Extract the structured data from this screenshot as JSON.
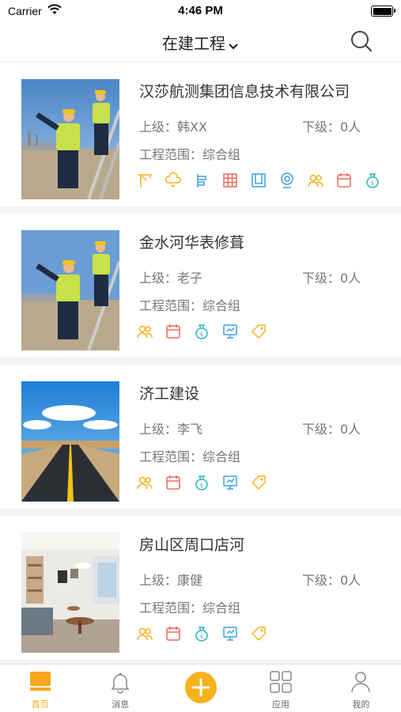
{
  "status": {
    "carrier": "Carrier",
    "time": "4:46 PM"
  },
  "header": {
    "title": "在建工程"
  },
  "projects": [
    {
      "title": "汉莎航测集团信息技术有限公司",
      "sup": "上级：韩XX",
      "sub": "下级：0人",
      "scope": "工程范围：综合组",
      "icons": [
        "crane-icon",
        "cloud-icon",
        "scaffold-icon",
        "grid-icon",
        "frame-icon",
        "camera-icon",
        "people-icon",
        "calendar-icon",
        "money-bag-icon"
      ]
    },
    {
      "title": "金水河华表修葺",
      "sup": "上级：老子",
      "sub": "下级：0人",
      "scope": "工程范围：综合组",
      "icons": [
        "people-icon",
        "calendar-icon",
        "money-bag-icon",
        "monitor-icon",
        "tag-icon"
      ]
    },
    {
      "title": "济工建设",
      "sup": "上级：李飞",
      "sub": "下级：0人",
      "scope": "工程范围：综合组",
      "icons": [
        "people-icon",
        "calendar-icon",
        "money-bag-icon",
        "monitor-icon",
        "tag-icon"
      ]
    },
    {
      "title": "房山区周口店河",
      "sup": "上级：康健",
      "sub": "下级：0人",
      "scope": "工程范围：综合组",
      "icons": [
        "people-icon",
        "calendar-icon",
        "money-bag-icon",
        "monitor-icon",
        "tag-icon"
      ]
    }
  ],
  "tabs": [
    {
      "label": "首页",
      "icon": "home-icon",
      "active": true
    },
    {
      "label": "消息",
      "icon": "bell-icon",
      "active": false
    },
    {
      "label": "",
      "icon": "plus-icon",
      "active": false
    },
    {
      "label": "应用",
      "icon": "apps-icon",
      "active": false
    },
    {
      "label": "我的",
      "icon": "user-icon",
      "active": false
    }
  ],
  "colors": {
    "accent": "#f6a71a",
    "orange": "#f6b21b",
    "blue": "#3aa0e8",
    "red": "#ee6b5b",
    "teal": "#2bb3c0"
  }
}
